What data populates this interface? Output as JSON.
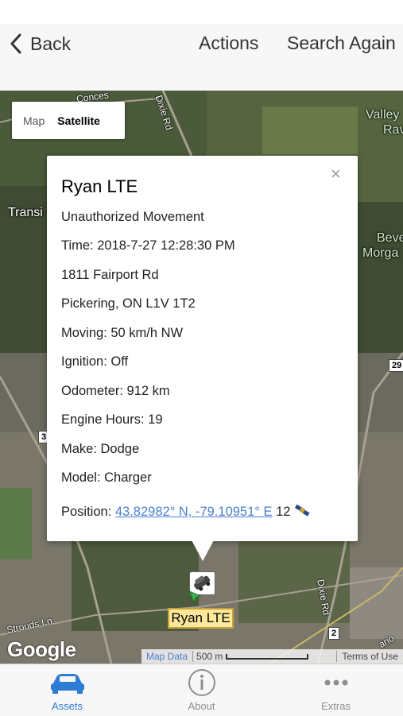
{
  "nav": {
    "back_label": "Back",
    "actions_label": "Actions",
    "search_label": "Search Again"
  },
  "maptype": {
    "map_label": "Map",
    "satellite_label": "Satellite",
    "selected": "Satellite"
  },
  "map_labels": {
    "concession": "Conces",
    "dixie_top": "Dixie Rd",
    "valley": "Valley",
    "ravine": "Rav",
    "transit": "Transi",
    "beverley": "Beve",
    "morgan": "Morga",
    "strouds": "Strouds Ln",
    "dixie_bottom": "Dixie Rd",
    "ontario": "ario",
    "shield_29": "29",
    "shield_3": "3",
    "shield_2": "2"
  },
  "popup": {
    "close_symbol": "×",
    "title": "Ryan LTE",
    "event": "Unauthorized Movement",
    "time": "Time: 2018-7-27 12:28:30 PM",
    "address1": "1811 Fairport Rd",
    "address2": "Pickering, ON L1V 1T2",
    "moving": "Moving: 50 km/h NW",
    "ignition": "Ignition: Off",
    "odometer": "Odometer: 912 km",
    "engine_hours": "Engine Hours: 19",
    "make": "Make: Dodge",
    "model": "Model: Charger",
    "position_prefix": "Position: ",
    "position_coords": "43.82982° N, -79.10951° E",
    "position_sats": "12"
  },
  "marker": {
    "label": "Ryan LTE",
    "icon": "car-icon"
  },
  "map_footer": {
    "google": "Google",
    "map_data": "Map Data",
    "scale": "500 m",
    "terms": "Terms of Use"
  },
  "tabs": [
    {
      "label": "Assets",
      "icon": "car-icon",
      "active": true
    },
    {
      "label": "About",
      "icon": "info-icon",
      "active": false
    },
    {
      "label": "Extras",
      "icon": "more-icon",
      "active": false
    }
  ],
  "colors": {
    "accent": "#2e7bd3",
    "link": "#4a7fd1",
    "marker_label_bg": "#fce89a"
  }
}
